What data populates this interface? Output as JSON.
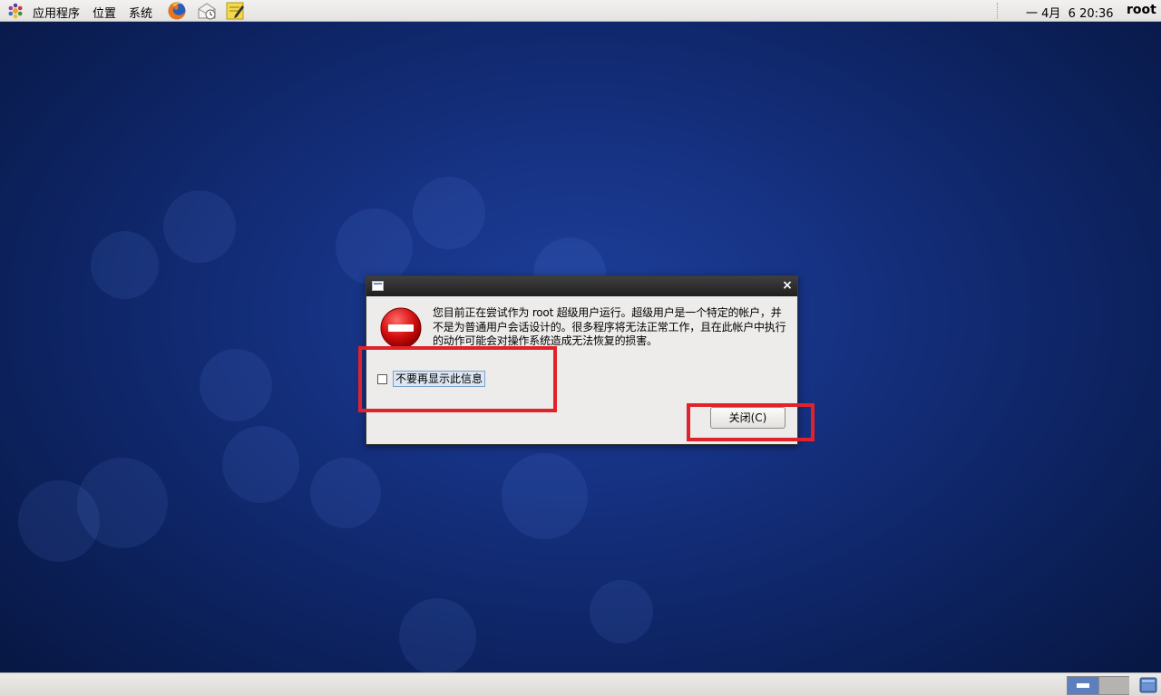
{
  "top_panel": {
    "menus": [
      "应用程序",
      "位置",
      "系统"
    ],
    "clock": "一 4月  6 20:36",
    "user": "root",
    "launchers": [
      "firefox-icon",
      "mail-clock-icon",
      "notes-icon"
    ]
  },
  "dialog": {
    "message": "您目前正在尝试作为 root 超级用户运行。超级用户是一个特定的帐户，并不是为普通用户会话设计的。很多程序将无法正常工作，且在此帐户中执行的动作可能会对操作系统造成无法恢复的损害。",
    "checkbox_label": "不要再显示此信息",
    "checkbox_checked": false,
    "close_button": "关闭(C)",
    "close_glyph": "×",
    "icon": "error-stop-icon"
  },
  "colors": {
    "highlight": "#e0222a",
    "titlebar": "#2a2a2a",
    "desktop": "#163283"
  }
}
